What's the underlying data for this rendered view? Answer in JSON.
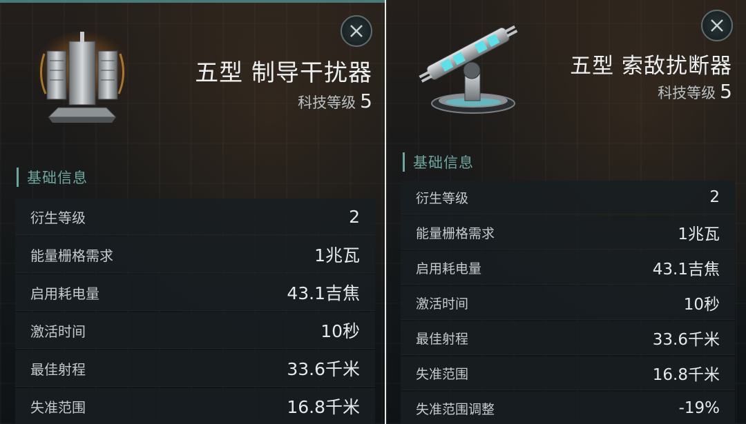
{
  "left_panel": {
    "title": "五型 制导干扰器",
    "tech_label": "科技等级",
    "tech_value": "5",
    "section_title": "基础信息",
    "icon": "guidance-disruptor-module-icon",
    "stats": [
      {
        "label": "衍生等级",
        "value": "2"
      },
      {
        "label": "能量栅格需求",
        "value": "1兆瓦"
      },
      {
        "label": "启用耗电量",
        "value": "43.1吉焦"
      },
      {
        "label": "激活时间",
        "value": "10秒"
      },
      {
        "label": "最佳射程",
        "value": "33.6千米"
      },
      {
        "label": "失准范围",
        "value": "16.8千米"
      }
    ]
  },
  "right_panel": {
    "title": "五型 索敌扰断器",
    "tech_label": "科技等级",
    "tech_value": "5",
    "section_title": "基础信息",
    "icon": "sensor-dampener-turret-icon",
    "stats": [
      {
        "label": "衍生等级",
        "value": "2"
      },
      {
        "label": "能量栅格需求",
        "value": "1兆瓦"
      },
      {
        "label": "启用耗电量",
        "value": "43.1吉焦"
      },
      {
        "label": "激活时间",
        "value": "10秒"
      },
      {
        "label": "最佳射程",
        "value": "33.6千米"
      },
      {
        "label": "失准范围",
        "value": "16.8千米"
      },
      {
        "label": "失准范围调整",
        "value": "-19%"
      }
    ]
  },
  "colors": {
    "accent": "#6fa6a0",
    "top_accent": "#4a7a78",
    "row_bg": "#181e21",
    "text": "#e6eaec"
  }
}
